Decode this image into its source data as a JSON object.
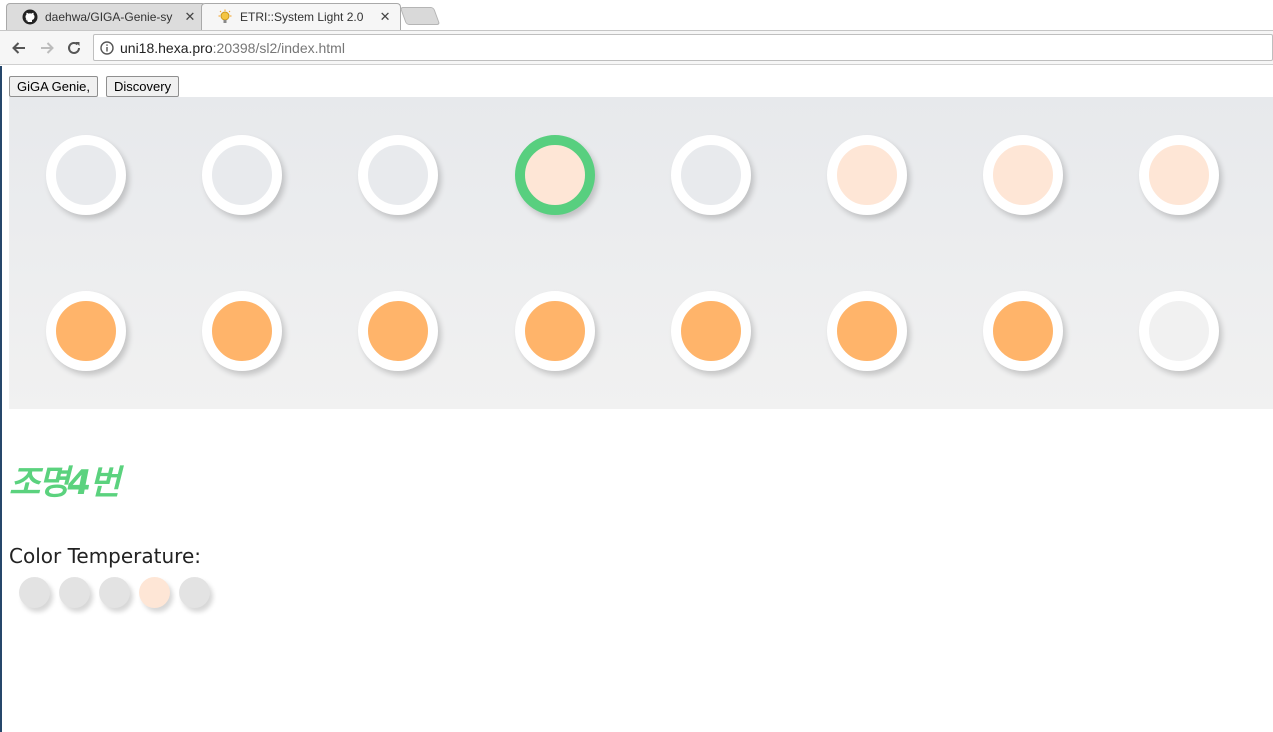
{
  "browser": {
    "tabs": [
      {
        "title": "daehwa/GIGA-Genie-sy",
        "icon": "github-icon",
        "active": false
      },
      {
        "title": "ETRI::System Light 2.0",
        "icon": "lightbulb-icon",
        "active": true
      }
    ],
    "url_host": "uni18.hexa.pro",
    "url_rest": ":20398/sl2/index.html"
  },
  "buttons": {
    "giga_genie": "GiGA Genie,",
    "discovery": "Discovery"
  },
  "colors": {
    "off": "#e8eaed",
    "warm_light": "#fee6d6",
    "orange": "#ffb46a",
    "selected_ring": "#58cf7f",
    "gray_dot": "#e3e3e3"
  },
  "lights": {
    "row1": [
      {
        "state": "off",
        "selected": false
      },
      {
        "state": "off",
        "selected": false
      },
      {
        "state": "off",
        "selected": false
      },
      {
        "state": "warm_light",
        "selected": true
      },
      {
        "state": "off",
        "selected": false
      },
      {
        "state": "warm_light",
        "selected": false
      },
      {
        "state": "warm_light",
        "selected": false
      },
      {
        "state": "warm_light",
        "selected": false
      }
    ],
    "row2": [
      {
        "state": "orange",
        "selected": false
      },
      {
        "state": "orange",
        "selected": false
      },
      {
        "state": "orange",
        "selected": false
      },
      {
        "state": "orange",
        "selected": false
      },
      {
        "state": "orange",
        "selected": false
      },
      {
        "state": "orange",
        "selected": false
      },
      {
        "state": "orange",
        "selected": false
      },
      {
        "state": "off_light",
        "selected": false
      }
    ]
  },
  "selected_light": {
    "name": "조명4번"
  },
  "color_temperature": {
    "label": "Color Temperature:",
    "options": [
      {
        "state": "gray_dot"
      },
      {
        "state": "gray_dot"
      },
      {
        "state": "gray_dot"
      },
      {
        "state": "warm_light"
      },
      {
        "state": "gray_dot"
      }
    ]
  }
}
